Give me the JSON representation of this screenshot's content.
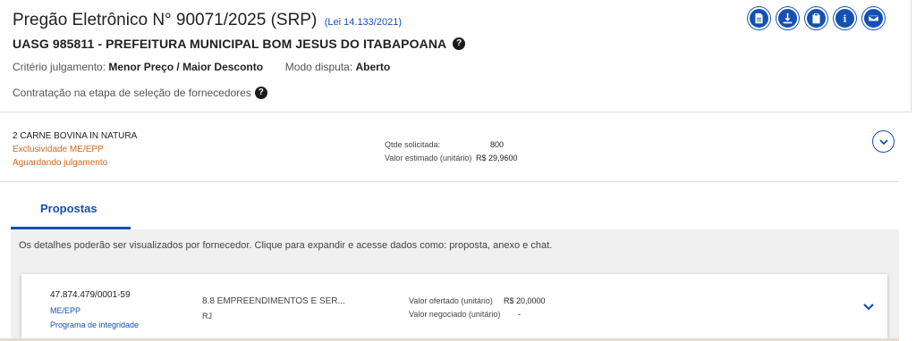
{
  "header": {
    "title": "Pregão Eletrônico N° 90071/2025 (SRP)",
    "lei": "(Lei 14.133/2021)",
    "uasg": "UASG 985811 - PREFEITURA MUNICIPAL BOM JESUS DO ITABAPOANA",
    "criterio_label": "Critério julgamento:",
    "criterio_value": "Menor Preço / Maior Desconto",
    "modo_label": "Modo disputa:",
    "modo_value": "Aberto",
    "contratacao": "Contratação na etapa de seleção de fornecedores",
    "help_icon": "question-circle-icon",
    "actions": [
      {
        "name": "document-icon"
      },
      {
        "name": "download-icon"
      },
      {
        "name": "clipboard-icon"
      },
      {
        "name": "info-icon"
      },
      {
        "name": "mail-icon"
      }
    ]
  },
  "item": {
    "name": "2  CARNE BOVINA IN NATURA",
    "exclusividade": "Exclusividade ME/EPP",
    "status": "Aguardando julgamento",
    "qtd_label": "Qtde solicitada:",
    "qtd_value": "800",
    "valor_label": "Valor estimado (unitário)",
    "valor_value": "R$ 29,9600"
  },
  "tabs": [
    {
      "label": "Propostas"
    }
  ],
  "info_text": "Os detalhes poderão ser visualizados por fornecedor. Clique para expandir e acesse dados como: proposta, anexo e chat.",
  "proposal": {
    "cnpj": "47.874.479/0001-59",
    "porte": "ME/EPP",
    "programa": "Programa de integridade",
    "fornecedor": "8.8 EMPREENDIMENTOS E SER...",
    "uf": "RJ",
    "ofertado_label": "Valor ofertado (unitário)",
    "ofertado_value": "R$ 20,0000",
    "negociado_label": "Valor negociado (unitário)",
    "negociado_value": "-"
  },
  "colors": {
    "primary": "#1351b4",
    "warning": "#d2691e",
    "panel": "#f0f0f0"
  }
}
